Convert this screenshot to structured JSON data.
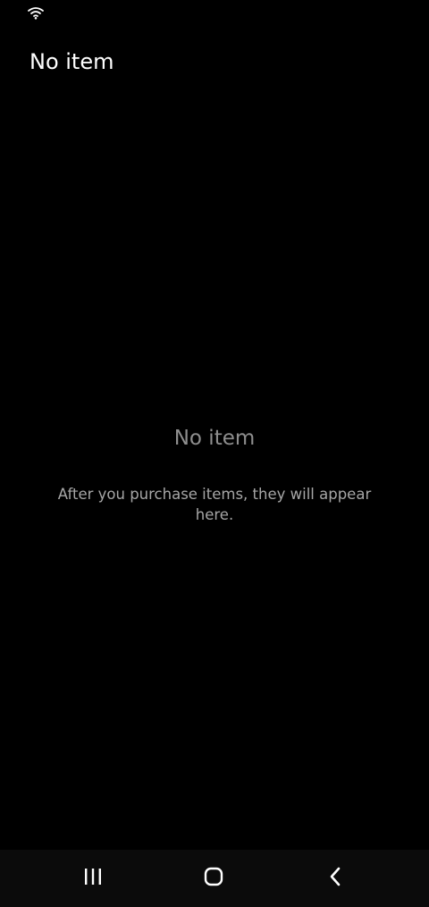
{
  "status_bar": {
    "icons": [
      "wifi-icon"
    ]
  },
  "header": {
    "title": "No item"
  },
  "empty_state": {
    "title": "No item",
    "message": "After you purchase items, they will appear here."
  },
  "navigation_bar": {
    "buttons": [
      {
        "name": "recents-button",
        "icon": "recents-icon"
      },
      {
        "name": "home-button",
        "icon": "home-icon"
      },
      {
        "name": "back-button",
        "icon": "back-icon"
      }
    ]
  },
  "colors": {
    "background": "#000000",
    "title_text": "#ffffff",
    "empty_title_text": "#8e8e8e",
    "empty_message_text": "#a6a6a6",
    "nav_bar_background": "#0b0b0b",
    "nav_icon": "#ffffff"
  }
}
